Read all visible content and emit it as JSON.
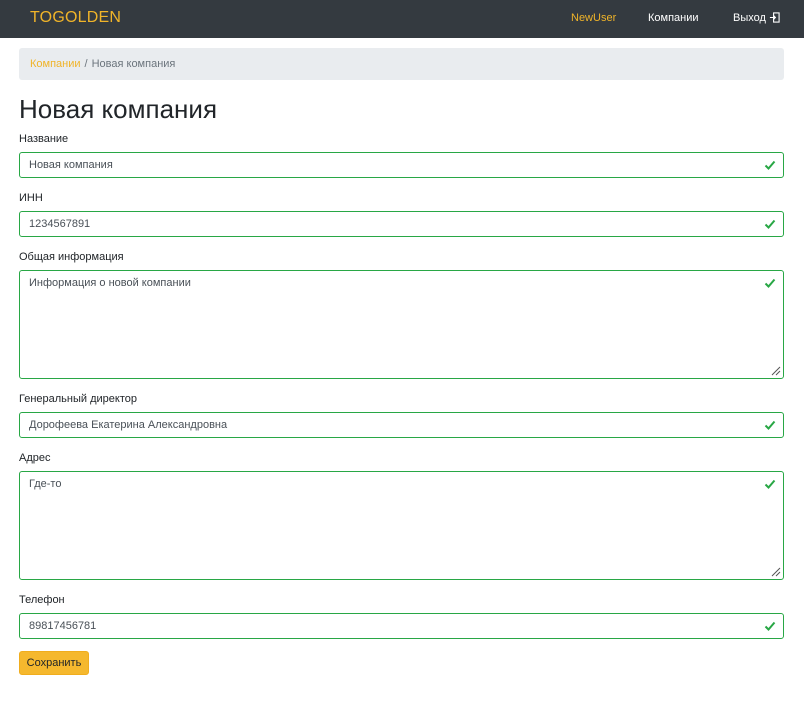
{
  "navbar": {
    "brand": "TOGOLDEN",
    "user": "NewUser",
    "companies": "Компании",
    "logout": "Выход"
  },
  "breadcrumb": {
    "parent": "Компании",
    "separator": "/",
    "current": "Новая компания"
  },
  "page_title": "Новая компания",
  "form": {
    "name": {
      "label": "Название",
      "value": "Новая компания"
    },
    "inn": {
      "label": "ИНН",
      "value": "1234567891"
    },
    "info": {
      "label": "Общая информация",
      "value": "Информация о новой компании"
    },
    "director": {
      "label": "Генеральный директор",
      "value": "Дорофеева Екатерина Александровна"
    },
    "address": {
      "label": "Адрес",
      "value": "Где-то"
    },
    "phone": {
      "label": "Телефон",
      "value": "89817456781"
    },
    "submit_label": "Сохранить"
  },
  "colors": {
    "navbar_bg": "#343a40",
    "accent": "#f0b429",
    "valid": "#28a745",
    "breadcrumb_bg": "#e9ecef"
  },
  "icons": {
    "logout": "logout-icon",
    "valid": "check-icon",
    "resize": "resize-handle-icon"
  }
}
